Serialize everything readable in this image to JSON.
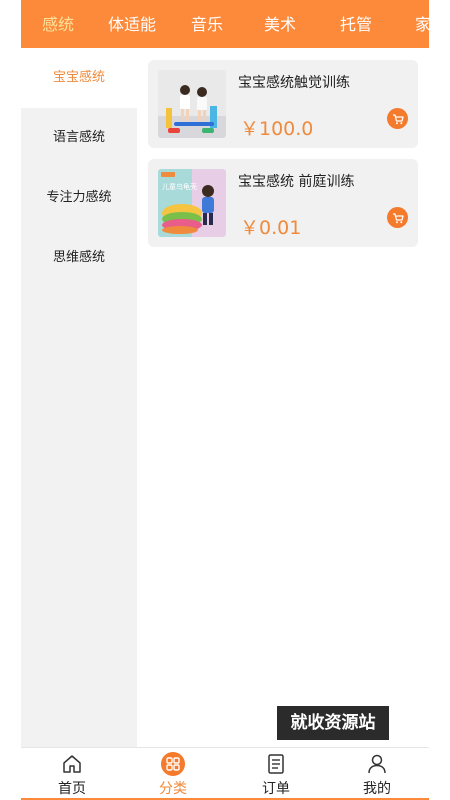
{
  "top_tabs": [
    {
      "label": "感统",
      "active": true
    },
    {
      "label": "体适能"
    },
    {
      "label": "音乐"
    },
    {
      "label": "美术"
    },
    {
      "label": "托管"
    },
    {
      "label": "家"
    }
  ],
  "sidebar": {
    "items": [
      {
        "label": "宝宝感统",
        "active": true
      },
      {
        "label": "语言感统"
      },
      {
        "label": "专注力感统"
      },
      {
        "label": "思维感统"
      }
    ]
  },
  "products": [
    {
      "title": "宝宝感统触觉训练",
      "price": "￥100.0",
      "cart_icon": "cart-icon"
    },
    {
      "title": "宝宝感统 前庭训练",
      "price": "￥0.01",
      "thumb_text": "儿童乌龟壳",
      "cart_icon": "cart-icon"
    }
  ],
  "watermark": "就收资源站",
  "bottom_nav": [
    {
      "label": "首页",
      "icon": "home-icon"
    },
    {
      "label": "分类",
      "icon": "grid-icon",
      "active": true
    },
    {
      "label": "订单",
      "icon": "order-icon"
    },
    {
      "label": "我的",
      "icon": "user-icon"
    }
  ],
  "colors": {
    "accent": "#fd8a3b",
    "active_text": "#f08a3c",
    "active_tab": "#fde29a",
    "sidebar_bg": "#f2f2f2",
    "card_bg": "#f1f1f1"
  }
}
